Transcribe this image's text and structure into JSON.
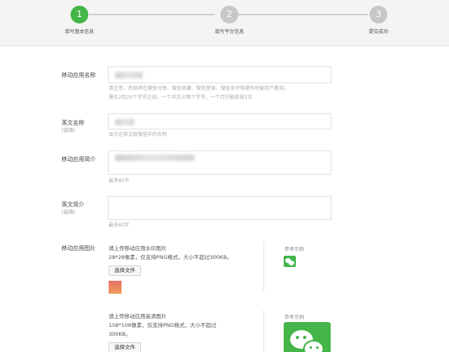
{
  "steps": [
    {
      "number": "1",
      "label": "填写基本信息",
      "state": "active"
    },
    {
      "number": "2",
      "label": "填写平台信息",
      "state": "inactive"
    },
    {
      "number": "3",
      "label": "提交成功",
      "state": "inactive"
    }
  ],
  "form": {
    "app_name": {
      "label": "移动应用名称",
      "hint_line1": "请注意，名称将在微信分享、微信收藏、微信登录、微信支付等操作时被用户看到，",
      "hint_line2": "需在2到20个字节之间，一个中文占两个字节，一个月只能修改1次"
    },
    "english_name": {
      "label": "英文名称",
      "optional": "(选填)",
      "hint": "显示在英文版微信中的名称"
    },
    "app_intro": {
      "label": "移动应用简介",
      "hint": "最多80字"
    },
    "english_intro": {
      "label": "英文简介",
      "optional": "(选填)",
      "hint": "最多80字"
    },
    "app_images": {
      "label": "移动应用图片",
      "small_icon": {
        "title": "请上传移动应用水印图片",
        "spec": "28*28像素，仅支持PNG格式，大小不超过300KB。",
        "button": "选择文件",
        "ref_label": "参考示例"
      },
      "large_icon": {
        "title": "请上传移动应用高清图片",
        "spec_line1": "108*108像素，仅支持PNG格式，大小不超过",
        "spec_line2": "300KB。",
        "button": "选择文件",
        "ref_label": "参考示例"
      }
    }
  },
  "colors": {
    "accent": "#44b549",
    "inactive_step": "#c7c7c7"
  }
}
